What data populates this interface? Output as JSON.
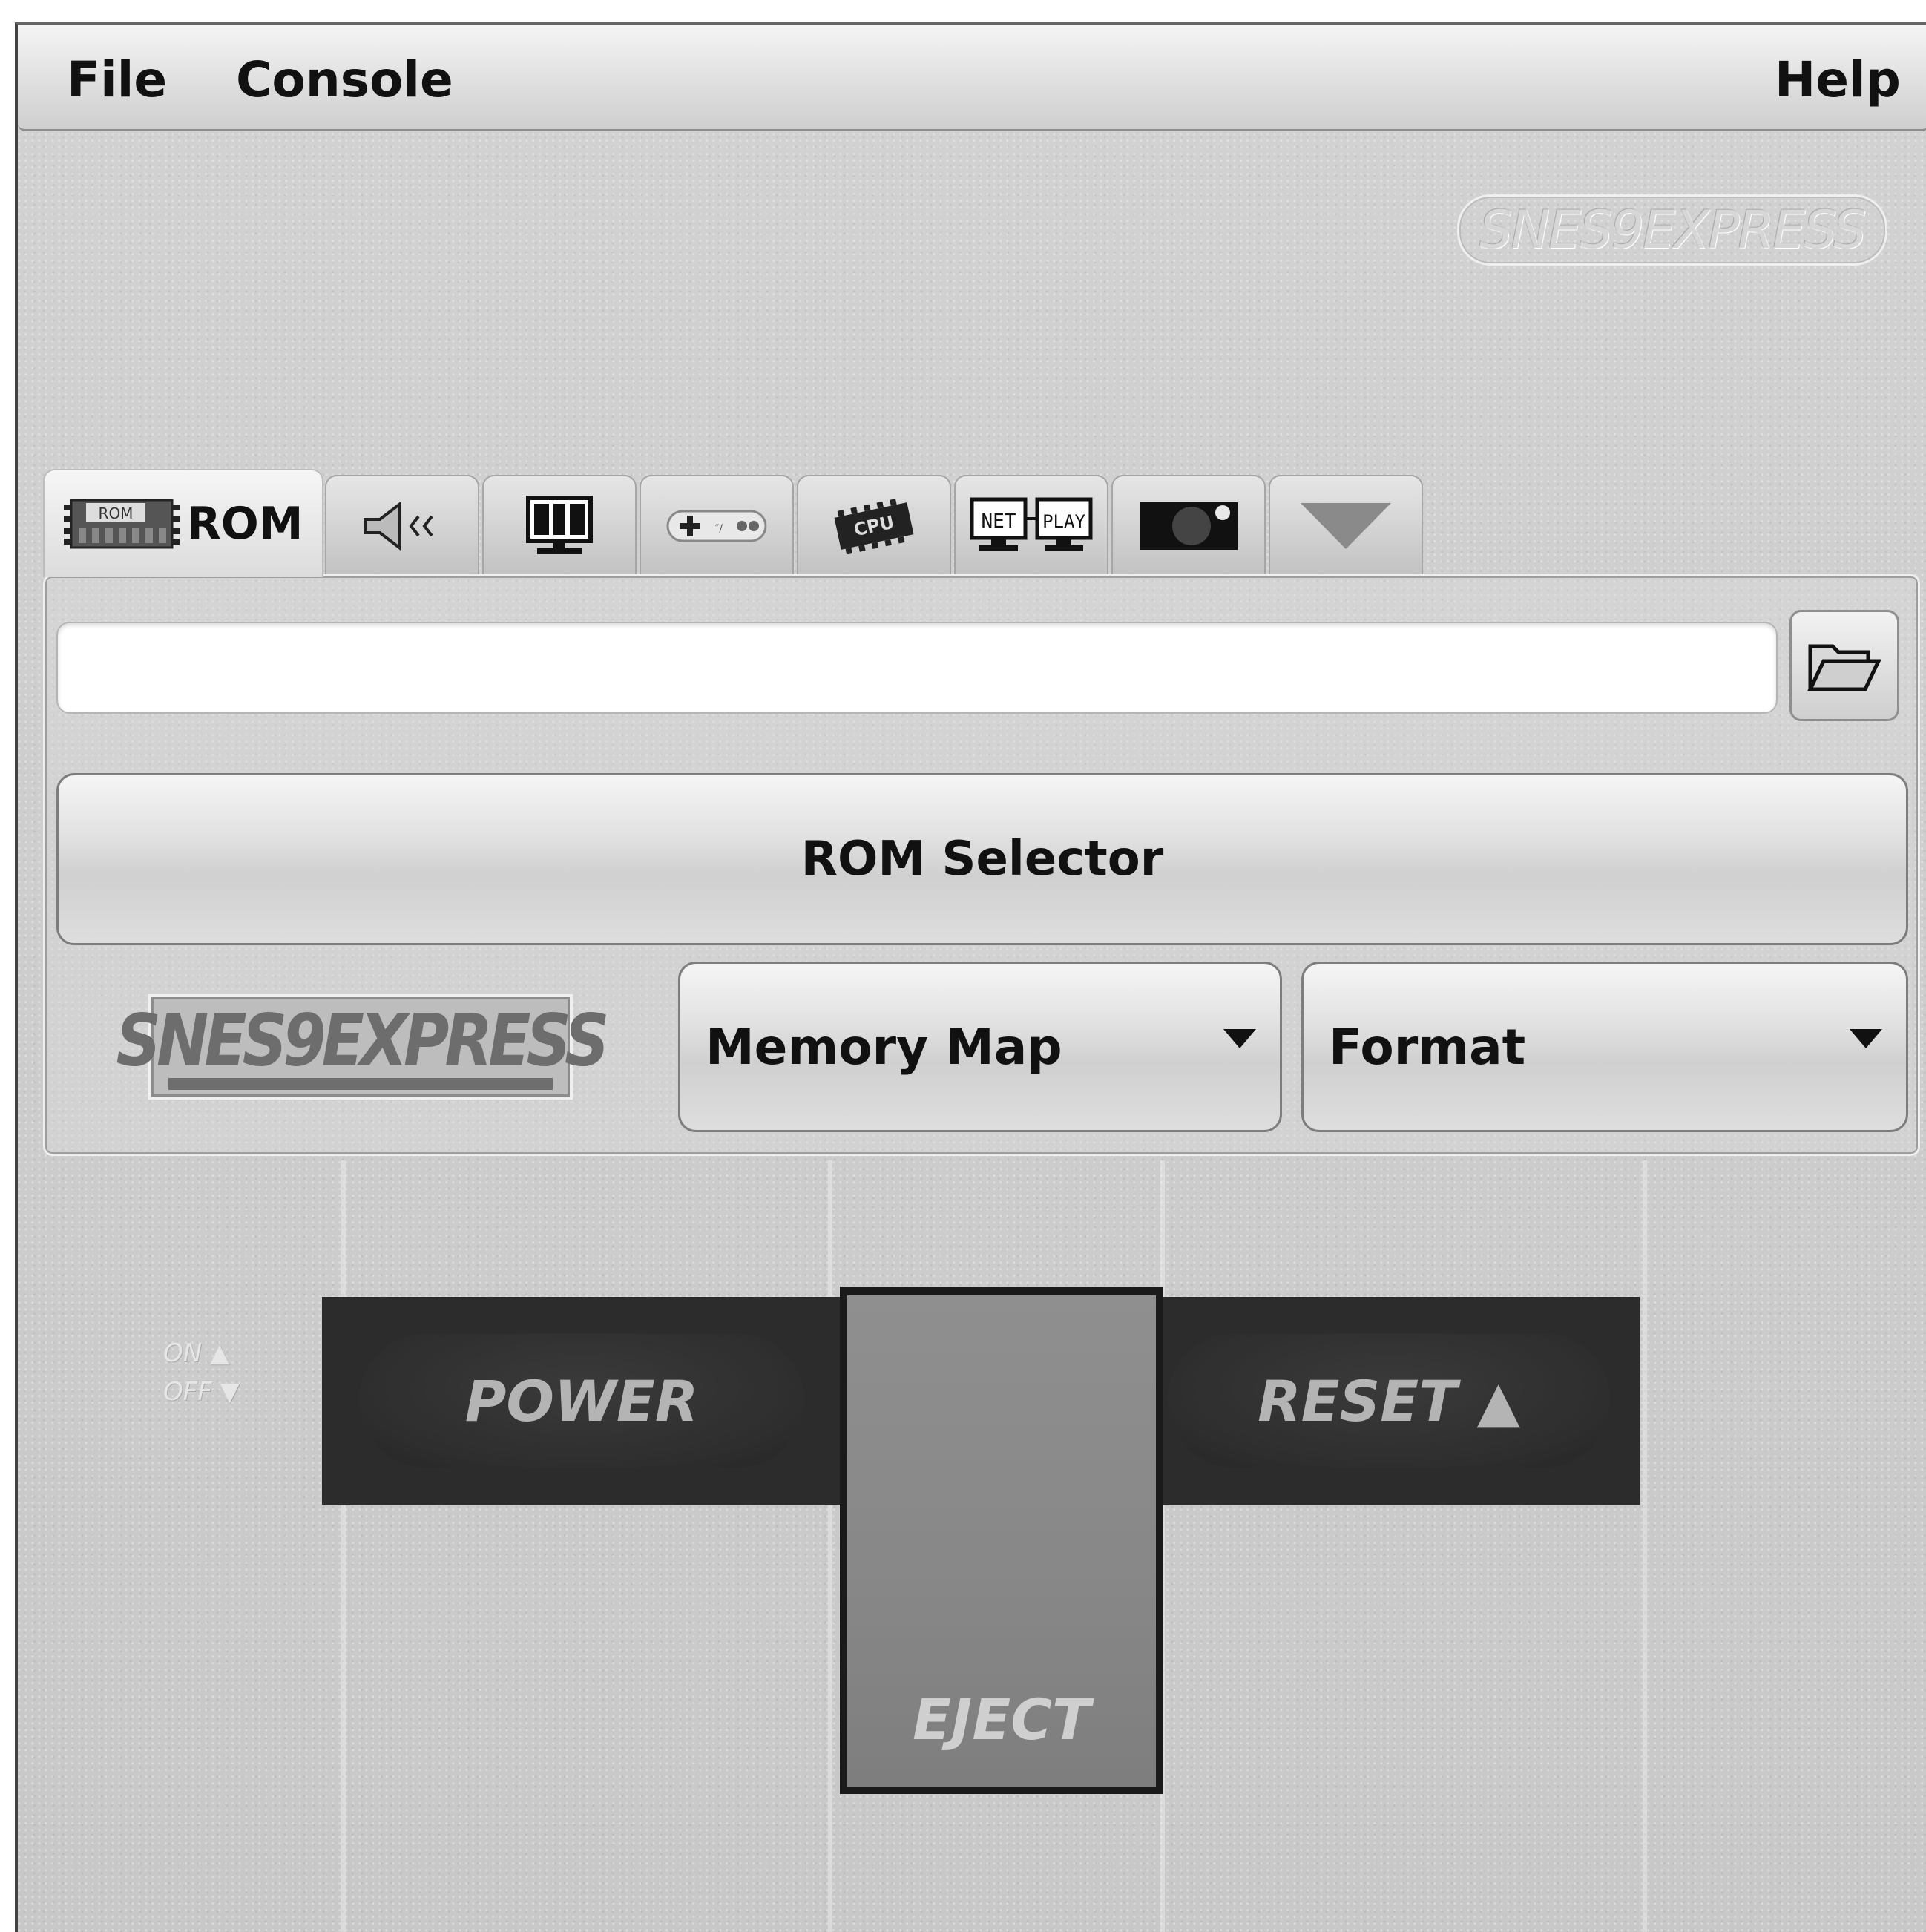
{
  "menu": {
    "file": "File",
    "console": "Console",
    "help": "Help"
  },
  "logo_top": "SNES9EXPRESS",
  "tabs": [
    {
      "label": "ROM",
      "icon": "rom-chip-icon",
      "active": true
    },
    {
      "icon": "speaker-icon"
    },
    {
      "icon": "monitor-icon"
    },
    {
      "icon": "gamepad-icon"
    },
    {
      "icon": "cpu-icon"
    },
    {
      "icon": "netplay-icon"
    },
    {
      "icon": "camera-icon"
    },
    {
      "icon": "more-arrow-icon"
    }
  ],
  "rom": {
    "path_value": "",
    "browse_icon": "folder-icon",
    "selector_label": "ROM Selector",
    "memory_map_label": "Memory Map",
    "format_label": "Format",
    "logo": "SNES9EXPRESS"
  },
  "console": {
    "onoff_1": "ON ▲",
    "onoff_2": "OFF ▼",
    "power_label": "POWER",
    "reset_label": "RESET ▲",
    "eject_label": "EJECT"
  }
}
